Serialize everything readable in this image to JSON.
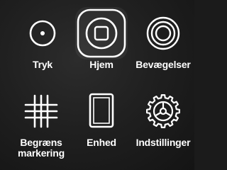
{
  "assistive_touch_menu": {
    "items": [
      {
        "label": "Tryk",
        "icon": "single-tap-icon"
      },
      {
        "label": "Hjem",
        "icon": "home-button-icon",
        "selected": true
      },
      {
        "label": "Bevægelser",
        "icon": "gestures-icon"
      },
      {
        "label": "Begræns",
        "label_line2": "markering",
        "icon": "grid-icon"
      },
      {
        "label": "Enhed",
        "icon": "device-icon"
      },
      {
        "label": "Indstillinger",
        "icon": "settings-gear-icon"
      }
    ]
  },
  "colors": {
    "background": "#1b1b1b",
    "icon_stroke": "#ffffff",
    "label": "#ffffff"
  }
}
